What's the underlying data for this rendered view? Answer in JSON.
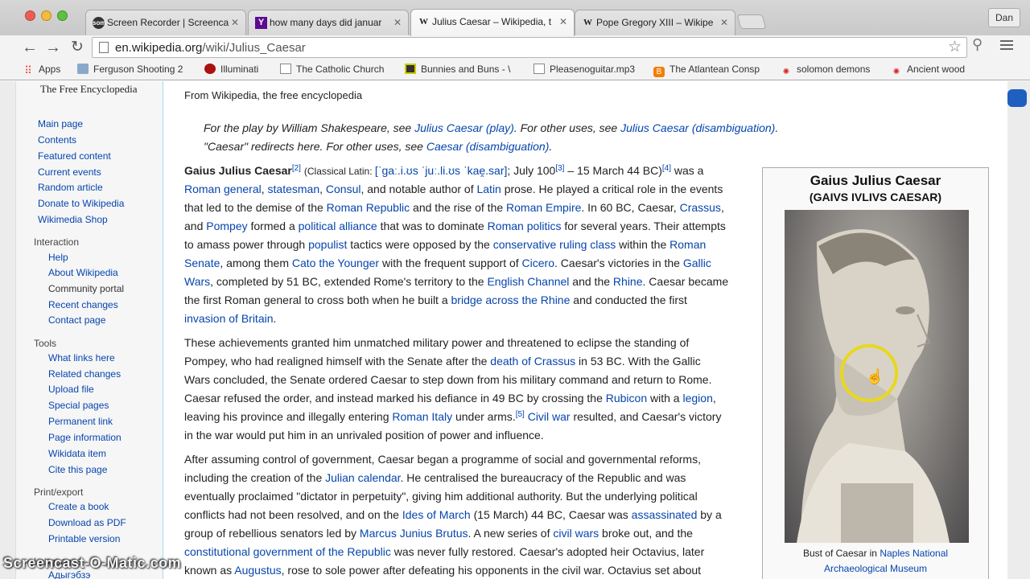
{
  "tabs": [
    {
      "icon": "som",
      "title": "Screen Recorder | Screenca"
    },
    {
      "icon": "Y",
      "title": "how many days did januar"
    },
    {
      "icon": "W",
      "title": "Julius Caesar – Wikipedia, t"
    },
    {
      "icon": "W",
      "title": "Pope Gregory XIII – Wikipe"
    }
  ],
  "profile": "Dan",
  "url": {
    "host": "en.wikipedia.org",
    "path": "/wiki/Julius_Caesar"
  },
  "bookmarks": [
    "Apps",
    "Ferguson Shooting 2",
    "Illuminati",
    "The Catholic Church",
    "Bunnies and Buns - \\",
    "Pleasenoguitar.mp3",
    "The Atlantean Consp",
    "solomon demons",
    "Ancient wood"
  ],
  "sidebar": {
    "tagline": "The Free Encyclopedia",
    "main": [
      "Main page",
      "Contents",
      "Featured content",
      "Current events",
      "Random article",
      "Donate to Wikipedia",
      "Wikimedia Shop"
    ],
    "interaction_head": "Interaction",
    "interaction": [
      "Help",
      "About Wikipedia",
      "Community portal",
      "Recent changes",
      "Contact page"
    ],
    "tools_head": "Tools",
    "tools": [
      "What links here",
      "Related changes",
      "Upload file",
      "Special pages",
      "Permanent link",
      "Page information",
      "Wikidata item",
      "Cite this page"
    ],
    "print_head": "Print/export",
    "print": [
      "Create a book",
      "Download as PDF",
      "Printable version"
    ],
    "languages_head": "Languages",
    "languages_first": "Адыгэбзэ"
  },
  "article": {
    "from": "From Wikipedia, the free encyclopedia",
    "hatnote1": {
      "pre": "For the play by William Shakespeare, see ",
      "link1": "Julius Caesar (play)",
      "mid": ". For other uses, see ",
      "link2": "Julius Caesar (disambiguation)",
      "post": "."
    },
    "hatnote2": {
      "pre": "\"Caesar\" redirects here. For other uses, see ",
      "link": "Caesar (disambiguation)",
      "post": "."
    }
  },
  "infobox": {
    "title": "Gaius Julius Caesar",
    "latin": "(GAIVS IVLIVS CAESAR)",
    "caption_pre": "Bust of Caesar in ",
    "caption_link1": "Naples National",
    "caption_link2": "Archaeological Museum"
  },
  "watermark": "Screencast-O-Matic.com",
  "colors": {
    "link": "#0645ad",
    "highlight": "#e8d81e",
    "scroll_thumb": "#1f5fbf"
  }
}
